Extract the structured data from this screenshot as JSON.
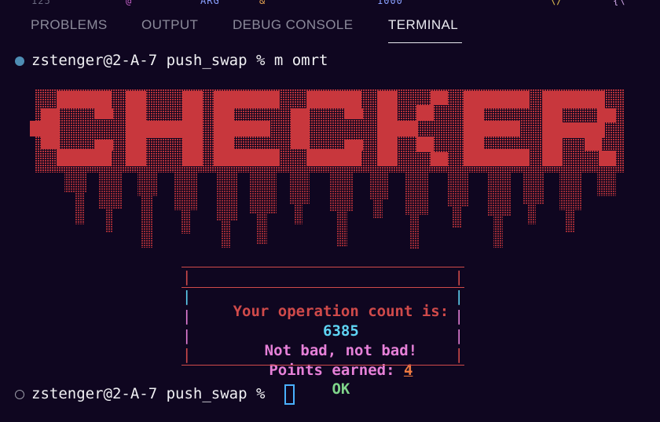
{
  "panel": {
    "tabs": [
      {
        "label": "PROBLEMS"
      },
      {
        "label": "OUTPUT"
      },
      {
        "label": "DEBUG CONSOLE"
      },
      {
        "label": "TERMINAL",
        "active": true
      }
    ]
  },
  "terminal": {
    "prompt_1": "zstenger@2-A-7 push_swap % m omrt",
    "banner_text": "CHECKER",
    "result_box": {
      "heading": "Your operation count is:",
      "count": "6385",
      "message": "Not bad, not bad!",
      "points_label": "Points earned: ",
      "points_value": "4",
      "status": "OK"
    },
    "prompt_2": "zstenger@2-A-7 push_swap % "
  },
  "colors": {
    "banner": "#c8373d",
    "box_border": "#d04a4a",
    "count": "#5fd4f4",
    "message": "#e680d8",
    "points_value": "#f07a40",
    "ok": "#7fd48a",
    "cursor": "#4ab0ff",
    "active_dot": "#4e8db4"
  }
}
